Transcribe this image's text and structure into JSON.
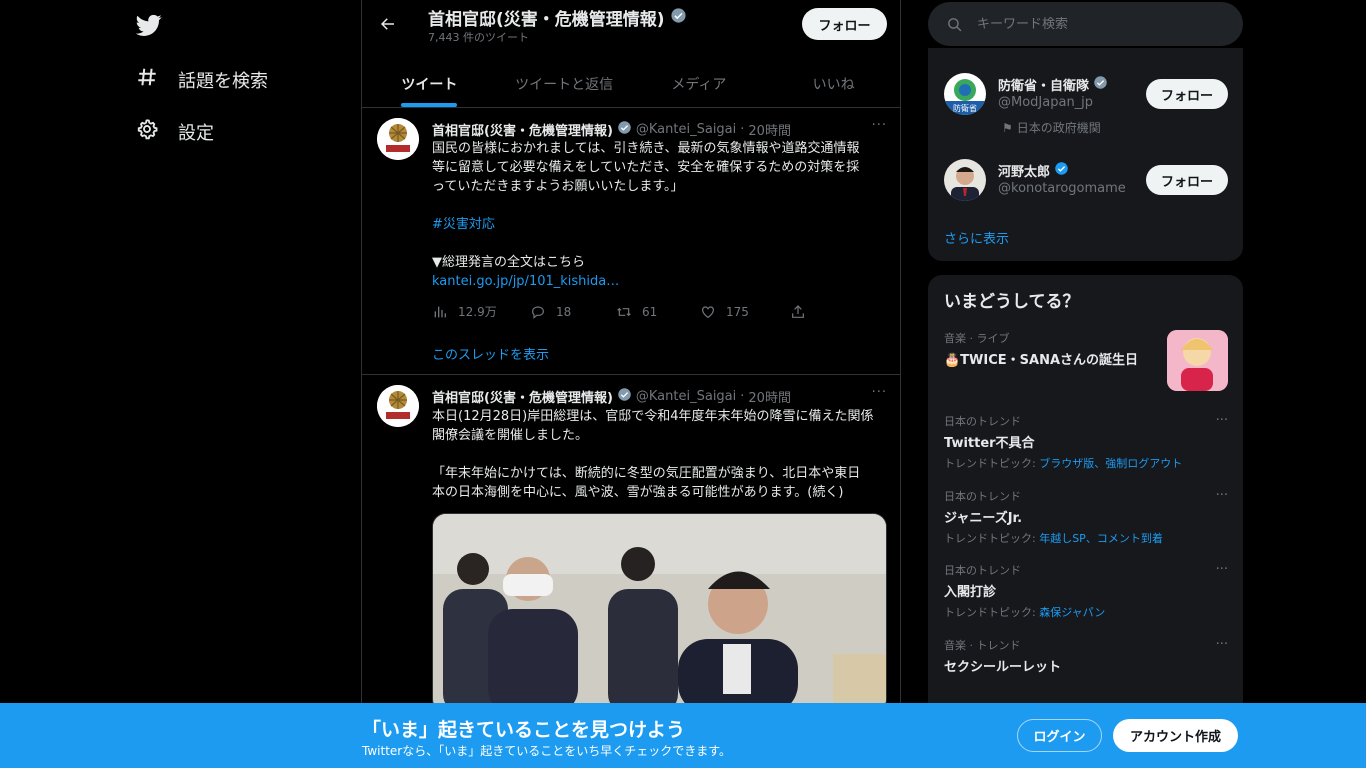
{
  "nav": {
    "logo": "twitter-bird-icon",
    "items": [
      {
        "label": "話題を検索",
        "icon": "hashtag-icon"
      },
      {
        "label": "設定",
        "icon": "gear-icon"
      }
    ]
  },
  "profile_header": {
    "name": "首相官邸(災害・危機管理情報)",
    "tweet_count": "7,443 件のツイート",
    "follow_label": "フォロー"
  },
  "tabs": [
    {
      "label": "ツイート",
      "active": true
    },
    {
      "label": "ツイートと返信",
      "active": false
    },
    {
      "label": "メディア",
      "active": false
    },
    {
      "label": "いいね",
      "active": false
    }
  ],
  "tweets": [
    {
      "name": "首相官邸(災害・危機管理情報)",
      "handle": "@Kantei_Saigai",
      "sep": "·",
      "time": "20時間",
      "more": "···",
      "lines": [
        "国民の皆様におかれましては、引き続き、最新の気象情報や道路交通情報",
        "等に留意して必要な備えをしていただき、安全を確保するための対策を採",
        "っていただきますようお願いいたします。」"
      ],
      "hashtag": "#災害対応",
      "line_after": "▼総理発言の全文はこちら",
      "link": "kantei.go.jp/jp/101_kishida…",
      "stats": {
        "views": "12.9万",
        "replies": "18",
        "retweets": "61",
        "likes": "175"
      },
      "thread_label": "このスレッドを表示"
    },
    {
      "name": "首相官邸(災害・危機管理情報)",
      "handle": "@Kantei_Saigai",
      "sep": "·",
      "time": "20時間",
      "more": "···",
      "lines": [
        "本日(12月28日)岸田総理は、官邸で令和4年度年末年始の降雪に備えた関係",
        "閣僚会議を開催しました。",
        "",
        "「年末年始にかけては、断続的に冬型の気圧配置が強まり、北日本や東日",
        "本の日本海側を中心に、風や波、雪が強まる可能性があります。(続く)"
      ]
    }
  ],
  "search": {
    "placeholder": "キーワード検索"
  },
  "who_to_follow": [
    {
      "name": "防衛省・自衛隊",
      "handle": "@ModJapan_jp",
      "meta": "日本の政府機関",
      "follow": "フォロー",
      "avatar_text": "防衛省"
    },
    {
      "name": "河野太郎",
      "handle": "@konotarogomame",
      "follow": "フォロー"
    }
  ],
  "show_more": "さらに表示",
  "trends_panel": {
    "title": "いまどうしてる？",
    "items": [
      {
        "category": "音楽 · ライブ",
        "name": "🎂TWICE・SANAさんの誕生日",
        "has_image": true
      },
      {
        "category": "日本のトレンド",
        "name": "Twitter不具合",
        "topics_prefix": "トレンドトピック: ",
        "topics": "ブラウザ版、強制ログアウト"
      },
      {
        "category": "日本のトレンド",
        "name": "ジャニーズJr.",
        "topics_prefix": "トレンドトピック: ",
        "topics": "年越しSP、コメント到着"
      },
      {
        "category": "日本のトレンド",
        "name": "入閣打診",
        "topics_prefix": "トレンドトピック: ",
        "topics": "森保ジャパン"
      },
      {
        "category": "音楽 · トレンド",
        "name": "セクシールーレット"
      }
    ],
    "more": "···"
  },
  "banner": {
    "title": "「いま」起きていることを見つけよう",
    "subtitle": "Twitterなら、「いま」起きていることをいち早くチェックできます。",
    "login": "ログイン",
    "signup": "アカウント作成"
  },
  "colors": {
    "accent": "#1d9bf0",
    "background": "#000000",
    "panel": "#16181c"
  }
}
